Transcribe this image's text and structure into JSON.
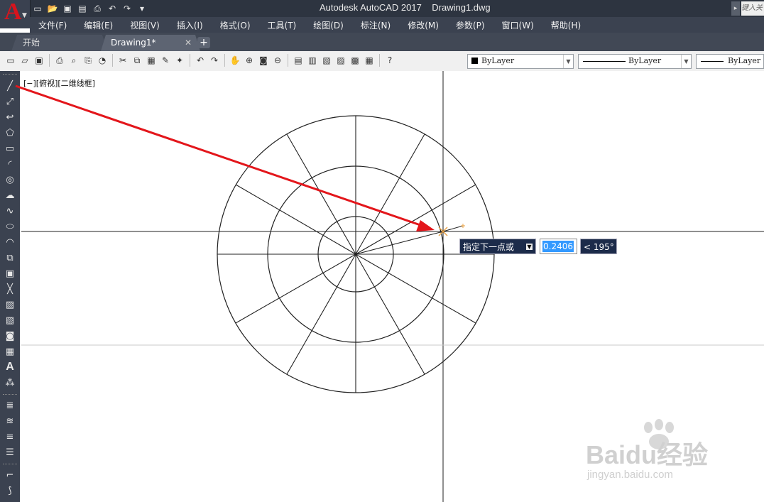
{
  "window": {
    "app_title": "Autodesk AutoCAD 2017",
    "doc_title": "Drawing1.dwg",
    "search_placeholder": "键入关"
  },
  "menu": [
    "文件(F)",
    "编辑(E)",
    "视图(V)",
    "插入(I)",
    "格式(O)",
    "工具(T)",
    "绘图(D)",
    "标注(N)",
    "修改(M)",
    "参数(P)",
    "窗口(W)",
    "帮助(H)"
  ],
  "tabs": {
    "start": "开始",
    "drawing": "Drawing1*",
    "close": "✕",
    "add": "+"
  },
  "toolbar": {
    "layer_color": "ByLayer",
    "linetype": "ByLayer",
    "lineweight": "ByLayer"
  },
  "viewport": {
    "label": "[−][俯视][二维线框]"
  },
  "tooltip": {
    "prompt": "指定下一点或",
    "input_value": "0.2406",
    "angle": "< 195°"
  },
  "watermark": {
    "logo": "Baidu经验",
    "url": "jingyan.baidu.com"
  },
  "colors": {
    "arrow": "#e3161b",
    "accent": "#d8141d",
    "tooltip_bg": "#1c2b4a"
  }
}
